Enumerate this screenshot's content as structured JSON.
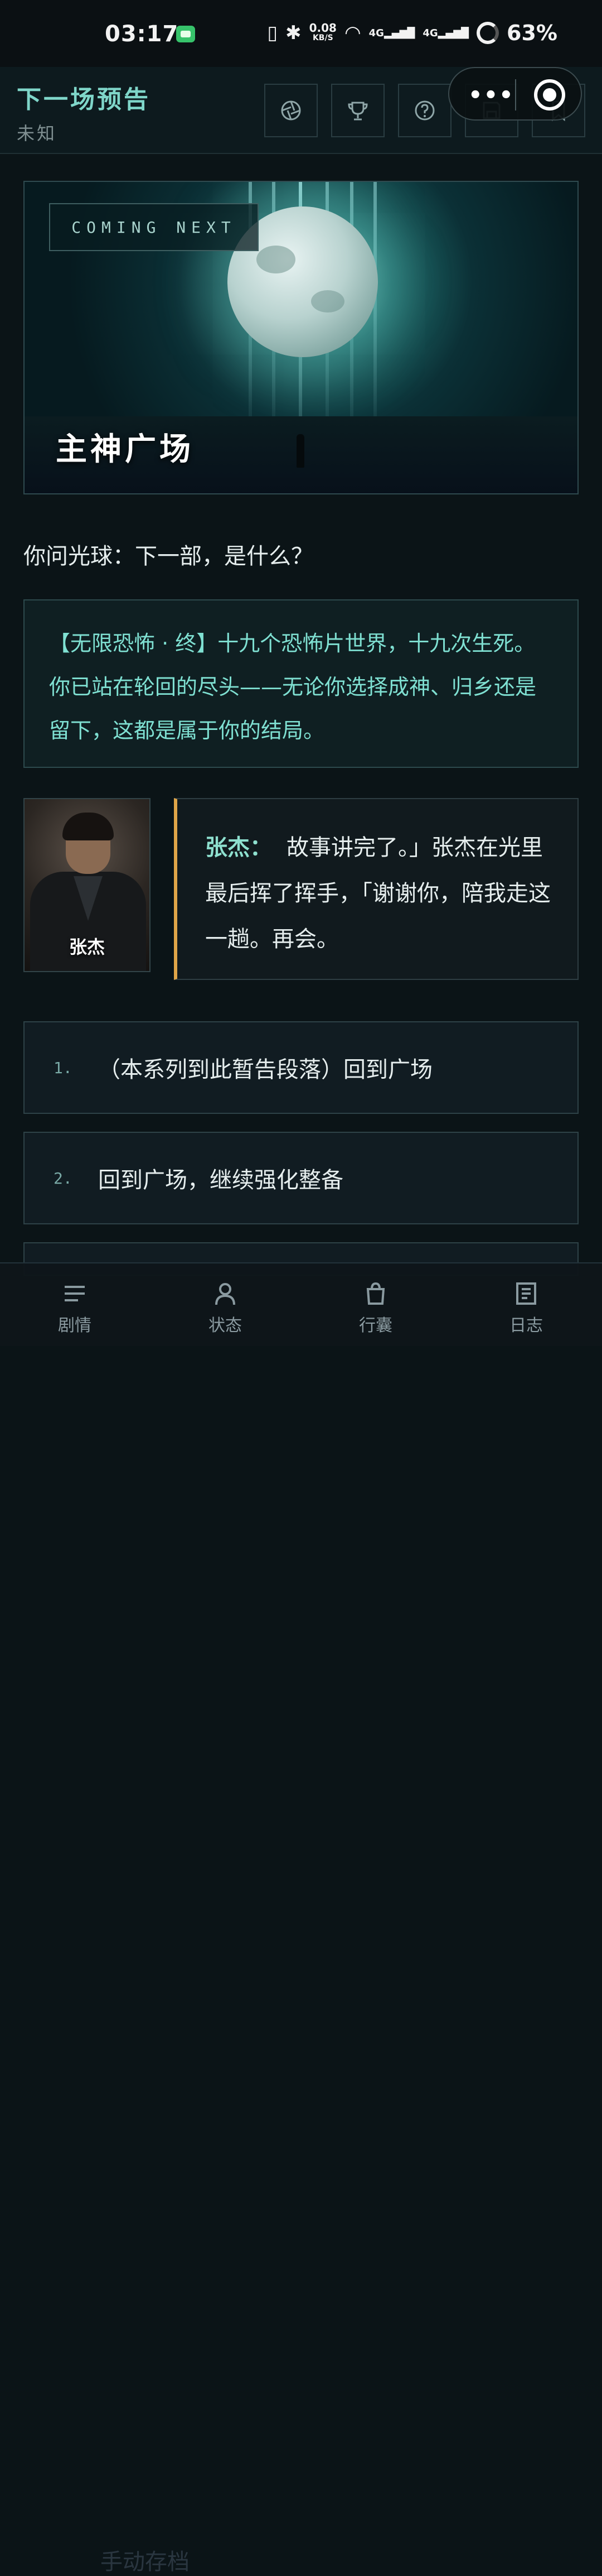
{
  "status_bar": {
    "time": "03:17",
    "net_speed": "0.08",
    "net_unit": "KB/S",
    "signal1": "4G",
    "signal2": "4G",
    "battery": "63%"
  },
  "header": {
    "title": "下一场预告",
    "subtitle": "未知",
    "icons": [
      "aperture-icon",
      "trophy-icon",
      "help-icon",
      "save-icon",
      "bookmark-icon"
    ]
  },
  "banner": {
    "tag": "COMING NEXT",
    "place": "主神广场"
  },
  "question": "你问光球：下一部，是什么？",
  "lore": {
    "text": "【无限恐怖  ·  终】十九个恐怖片世界，十九次生死。你已站在轮回的尽头——无论你选择成神、归乡还是留下，这都是属于你的结局。"
  },
  "dialog": {
    "portrait_name": "张杰",
    "speaker": "张杰：",
    "text": "故事讲完了。」张杰在光里最后挥了挥手，「谢谢你，陪我走这一趟。再会。"
  },
  "options": [
    {
      "num": "1.",
      "label": "（本系列到此暂告段落）回到广场"
    },
    {
      "num": "2.",
      "label": "回到广场，继续强化整备"
    },
    {
      "num": "",
      "label": "手动存档"
    }
  ],
  "bottom_nav": [
    {
      "label": "剧情",
      "icon": "menu-icon"
    },
    {
      "label": "状态",
      "icon": "person-icon"
    },
    {
      "label": "行囊",
      "icon": "bag-icon"
    },
    {
      "label": "日志",
      "icon": "log-icon"
    }
  ],
  "colors": {
    "accent": "#7fd6c9",
    "dialog_border": "#e0a548",
    "background": "#0b1417"
  }
}
